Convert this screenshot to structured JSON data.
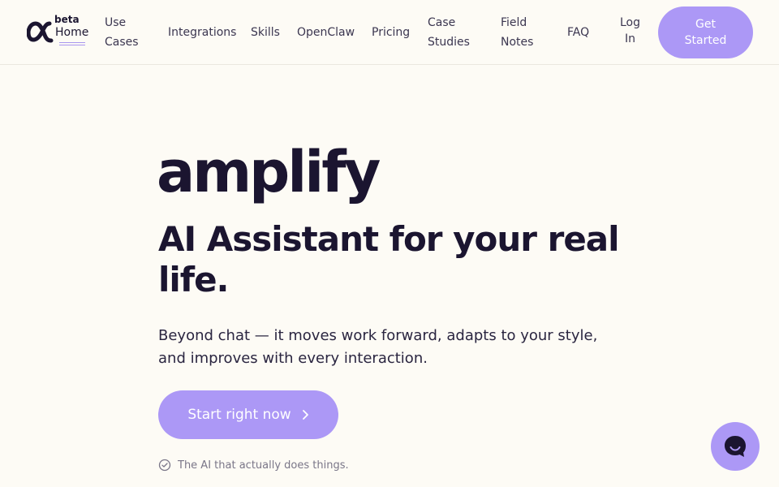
{
  "header": {
    "logo": {
      "mark_icon": "alpha-logo-icon",
      "badge": "beta",
      "home_label": "Home"
    },
    "nav": [
      {
        "id": "use-cases",
        "line1": "Use",
        "line2": "Cases"
      },
      {
        "id": "integrations",
        "label": "Integrations"
      },
      {
        "id": "skills",
        "label": "Skills"
      },
      {
        "id": "openclaw",
        "label": "OpenClaw"
      },
      {
        "id": "pricing",
        "label": "Pricing"
      },
      {
        "id": "case-studies",
        "line1": "Case",
        "line2": "Studies"
      },
      {
        "id": "field-notes",
        "line1": "Field",
        "line2": "Notes"
      },
      {
        "id": "faq",
        "label": "FAQ"
      },
      {
        "id": "log-in",
        "line1": "Log",
        "line2": "In"
      }
    ],
    "cta": {
      "line1": "Get",
      "line2": "Started"
    }
  },
  "hero": {
    "brand": "amplify",
    "title": "AI Assistant for your real life.",
    "subtitle_line1": "Beyond chat — it moves work forward, adapts to your style,",
    "subtitle_line2": "and improves with every interaction.",
    "cta_label": "Start right now",
    "cta_icon": "chevron-right-icon",
    "tagline": "The AI that actually does things.",
    "tagline_icon": "check-circle-icon"
  },
  "chat_widget": {
    "icon": "chat-bubble-icon"
  },
  "colors": {
    "background": "#fdfbf5",
    "accent": "#ac98f6",
    "text_dark": "#1b1530",
    "text_muted": "#7a7688"
  }
}
